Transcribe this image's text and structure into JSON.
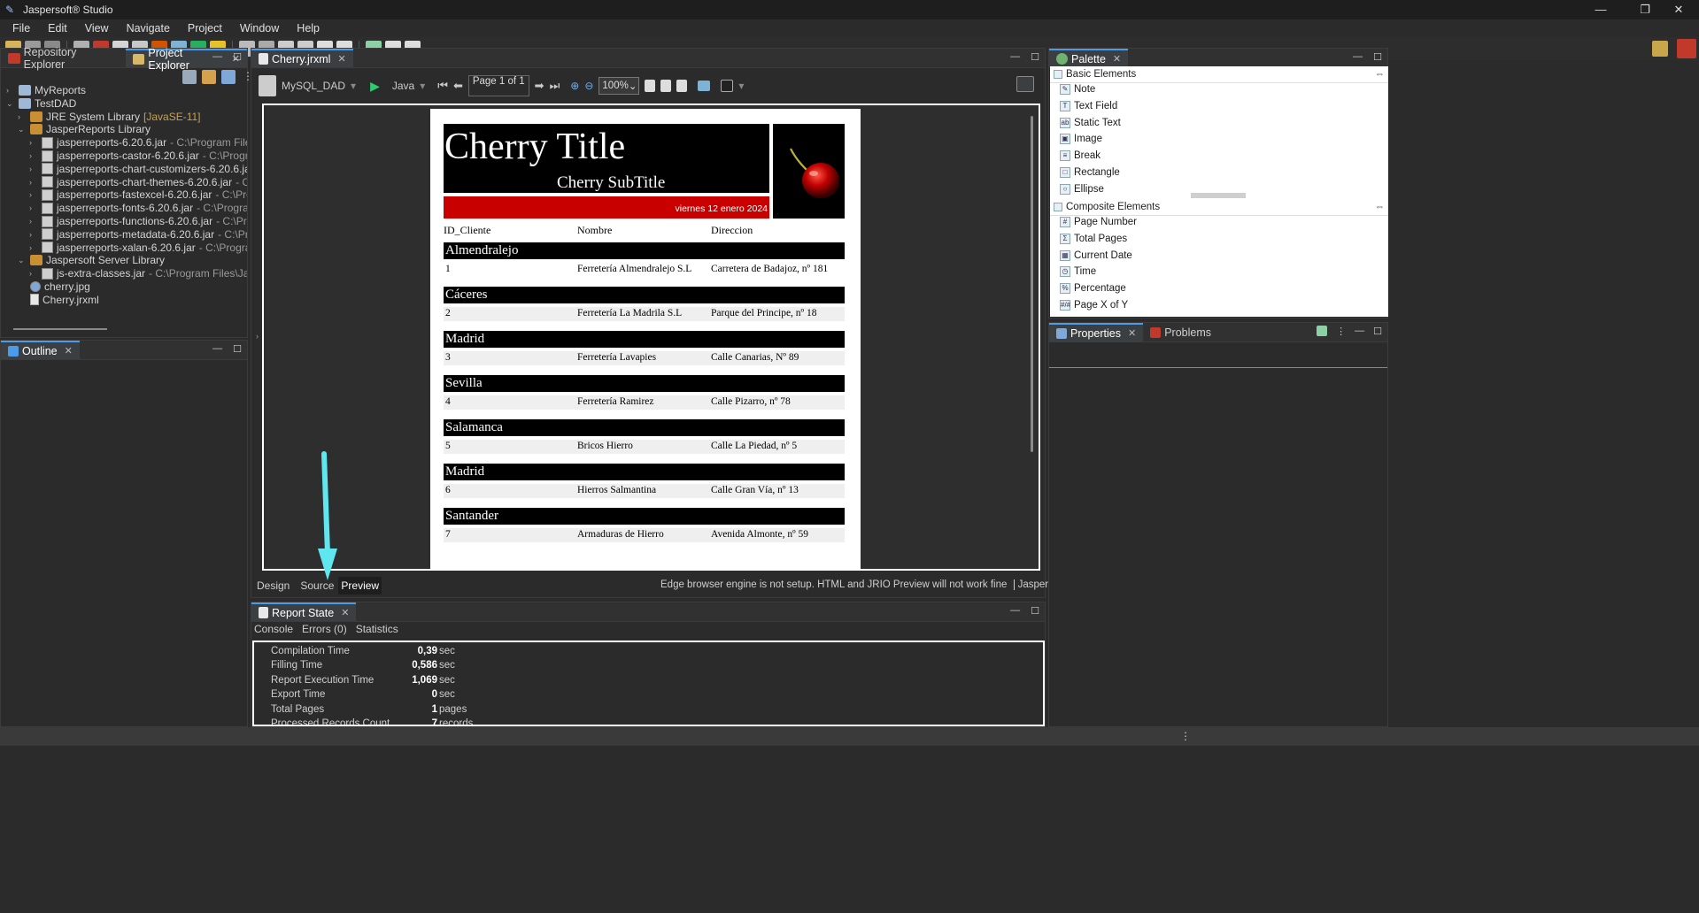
{
  "window": {
    "title": "Jaspersoft® Studio"
  },
  "menu": [
    "File",
    "Edit",
    "View",
    "Navigate",
    "Project",
    "Window",
    "Help"
  ],
  "left_panel": {
    "tabs": [
      "Repository Explorer",
      "Project Explorer"
    ],
    "tree": [
      {
        "label": "MyReports",
        "level": 0,
        "icon": "project-icon",
        "expanded": false
      },
      {
        "label": "TestDAD",
        "level": 0,
        "icon": "project-icon",
        "expanded": true
      },
      {
        "label": "JRE System Library",
        "extra": "[JavaSE-11]",
        "level": 1,
        "icon": "library-icon",
        "expanded": false
      },
      {
        "label": "JasperReports Library",
        "level": 1,
        "icon": "library-icon",
        "expanded": true
      },
      {
        "label": "jasperreports-6.20.6.jar",
        "extra": "- C:\\Program Files\\Jaspersoft",
        "level": 2,
        "icon": "jar-icon"
      },
      {
        "label": "jasperreports-castor-6.20.6.jar",
        "extra": "- C:\\Program Files\\Ja",
        "level": 2,
        "icon": "jar-icon"
      },
      {
        "label": "jasperreports-chart-customizers-6.20.6.jar",
        "extra": "- C:\\Prog",
        "level": 2,
        "icon": "jar-icon"
      },
      {
        "label": "jasperreports-chart-themes-6.20.6.jar",
        "extra": "- C:\\Program",
        "level": 2,
        "icon": "jar-icon"
      },
      {
        "label": "jasperreports-fastexcel-6.20.6.jar",
        "extra": "- C:\\Program Files",
        "level": 2,
        "icon": "jar-icon"
      },
      {
        "label": "jasperreports-fonts-6.20.6.jar",
        "extra": "- C:\\Program Files\\Jas",
        "level": 2,
        "icon": "jar-icon"
      },
      {
        "label": "jasperreports-functions-6.20.6.jar",
        "extra": "- C:\\Program File",
        "level": 2,
        "icon": "jar-icon"
      },
      {
        "label": "jasperreports-metadata-6.20.6.jar",
        "extra": "- C:\\Program File",
        "level": 2,
        "icon": "jar-icon"
      },
      {
        "label": "jasperreports-xalan-6.20.6.jar",
        "extra": "- C:\\Program Files\\Ja",
        "level": 2,
        "icon": "jar-icon"
      },
      {
        "label": "Jaspersoft Server Library",
        "level": 1,
        "icon": "library-icon",
        "expanded": true
      },
      {
        "label": "js-extra-classes.jar",
        "extra": "- C:\\Program Files\\Jaspersoft\\Ja",
        "level": 2,
        "icon": "jar-icon"
      },
      {
        "label": "cherry.jpg",
        "level": 1,
        "icon": "image-file-icon"
      },
      {
        "label": "Cherry.jrxml",
        "level": 1,
        "icon": "jrxml-file-icon"
      }
    ]
  },
  "outline": {
    "tab": "Outline"
  },
  "editor": {
    "tab": "Cherry.jrxml",
    "datasource": "MySQL_DAD",
    "language": "Java",
    "page_indicator": "Page 1 of 1",
    "zoom": "100%",
    "bottom_tabs": [
      "Design",
      "Source",
      "Preview"
    ],
    "active_bottom_tab": "Preview",
    "edge_message": "Edge browser engine is not setup. HTML and JRIO Preview will not work fine",
    "library_link": "JasperReports Library"
  },
  "report": {
    "title": "Cherry Title",
    "subtitle": "Cherry SubTitle",
    "date": "viernes 12 enero 2024",
    "columns": [
      "ID_Cliente",
      "Nombre",
      "Direccion"
    ],
    "groups": [
      {
        "group": "Almendralejo",
        "id": "1",
        "nombre": "Ferretería Almendralejo S.L",
        "direccion": "Carretera de Badajoz, nº 181"
      },
      {
        "group": "Cáceres",
        "id": "2",
        "nombre": "Ferretería La Madrila S.L",
        "direccion": "Parque del Principe, nº 18"
      },
      {
        "group": "Madrid",
        "id": "3",
        "nombre": "Ferretería Lavapies",
        "direccion": "Calle Canarias, Nº 89"
      },
      {
        "group": "Sevilla",
        "id": "4",
        "nombre": "Ferretería Ramirez",
        "direccion": "Calle Pizarro, nº 78"
      },
      {
        "group": "Salamanca",
        "id": "5",
        "nombre": "Bricos Hierro",
        "direccion": "Calle La Piedad, nº 5"
      },
      {
        "group": "Madrid",
        "id": "6",
        "nombre": "Hierros Salmantina",
        "direccion": "Calle Gran Vía, nº 13"
      },
      {
        "group": "Santander",
        "id": "7",
        "nombre": "Armaduras de Hierro",
        "direccion": "Avenida Almonte, nº 59"
      }
    ]
  },
  "report_state": {
    "tab": "Report State",
    "subtabs": [
      "Console",
      "Errors (0)",
      "Statistics"
    ],
    "stats": [
      {
        "label": "Compilation Time",
        "value": "0,39",
        "unit": "sec"
      },
      {
        "label": "Filling Time",
        "value": "0,586",
        "unit": "sec"
      },
      {
        "label": "Report Execution Time",
        "value": "1,069",
        "unit": "sec"
      },
      {
        "label": "Export Time",
        "value": "0",
        "unit": "sec"
      },
      {
        "label": "Total Pages",
        "value": "1",
        "unit": "pages"
      },
      {
        "label": "Processed Records Count",
        "value": "7",
        "unit": "records"
      }
    ]
  },
  "palette": {
    "tab": "Palette",
    "basic_header": "Basic Elements",
    "basic": [
      {
        "label": "Note",
        "icon": "note-icon"
      },
      {
        "label": "Text Field",
        "icon": "text-field-icon"
      },
      {
        "label": "Static Text",
        "icon": "static-text-icon"
      },
      {
        "label": "Image",
        "icon": "image-icon"
      },
      {
        "label": "Break",
        "icon": "break-icon"
      },
      {
        "label": "Rectangle",
        "icon": "rectangle-icon"
      },
      {
        "label": "Ellipse",
        "icon": "ellipse-icon"
      }
    ],
    "composite_header": "Composite Elements",
    "composite": [
      {
        "label": "Page Number",
        "icon": "page-number-icon"
      },
      {
        "label": "Total Pages",
        "icon": "total-pages-icon"
      },
      {
        "label": "Current Date",
        "icon": "current-date-icon"
      },
      {
        "label": "Time",
        "icon": "time-icon"
      },
      {
        "label": "Percentage",
        "icon": "percentage-icon"
      },
      {
        "label": "Page X of Y",
        "icon": "page-x-of-y-icon"
      }
    ]
  },
  "properties": {
    "tabs": [
      "Properties",
      "Problems"
    ]
  },
  "colors": {
    "accent": "#4d9be8",
    "report_red": "#c80000",
    "arrow": "#5fe6ee"
  }
}
